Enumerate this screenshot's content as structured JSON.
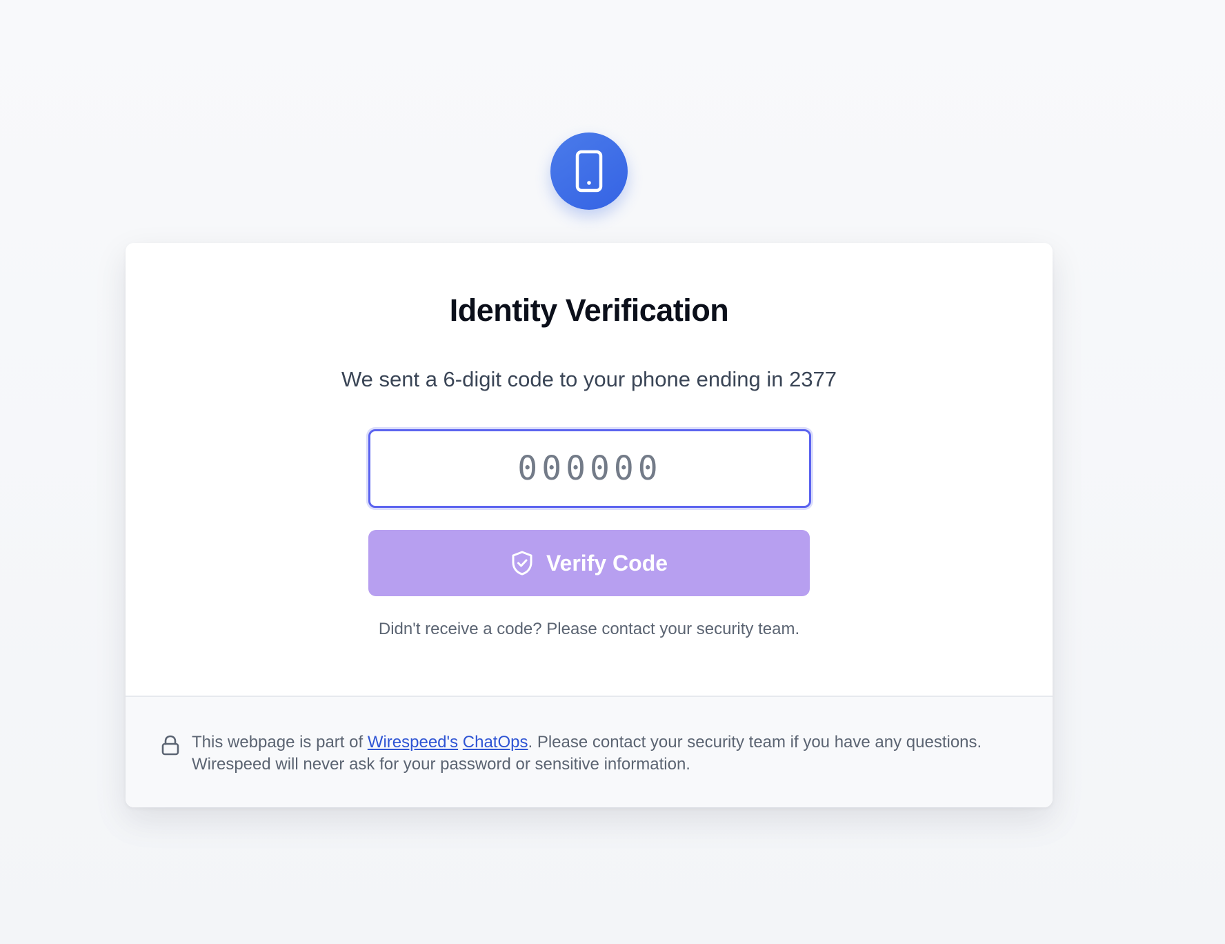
{
  "header_icon": "phone-icon",
  "title": "Identity Verification",
  "subtitle": "We sent a 6-digit code to your phone ending in 2377",
  "code_input": {
    "placeholder": "000000",
    "value": ""
  },
  "verify_button": {
    "label": "Verify Code",
    "icon": "shield-check-icon",
    "color": "#b79ff0"
  },
  "help_text": "Didn't receive a code? Please contact your security team.",
  "footer": {
    "icon": "lock-icon",
    "text_before": "This webpage is part of ",
    "link_company": "Wirespeed's",
    "link_product": "ChatOps",
    "text_after": ". Please contact your security team if you have any questions. Wirespeed will never ask for your password or sensitive information."
  },
  "colors": {
    "accent_blue": "#3563e4",
    "input_border": "#5b63ef",
    "link": "#2f55d4"
  }
}
